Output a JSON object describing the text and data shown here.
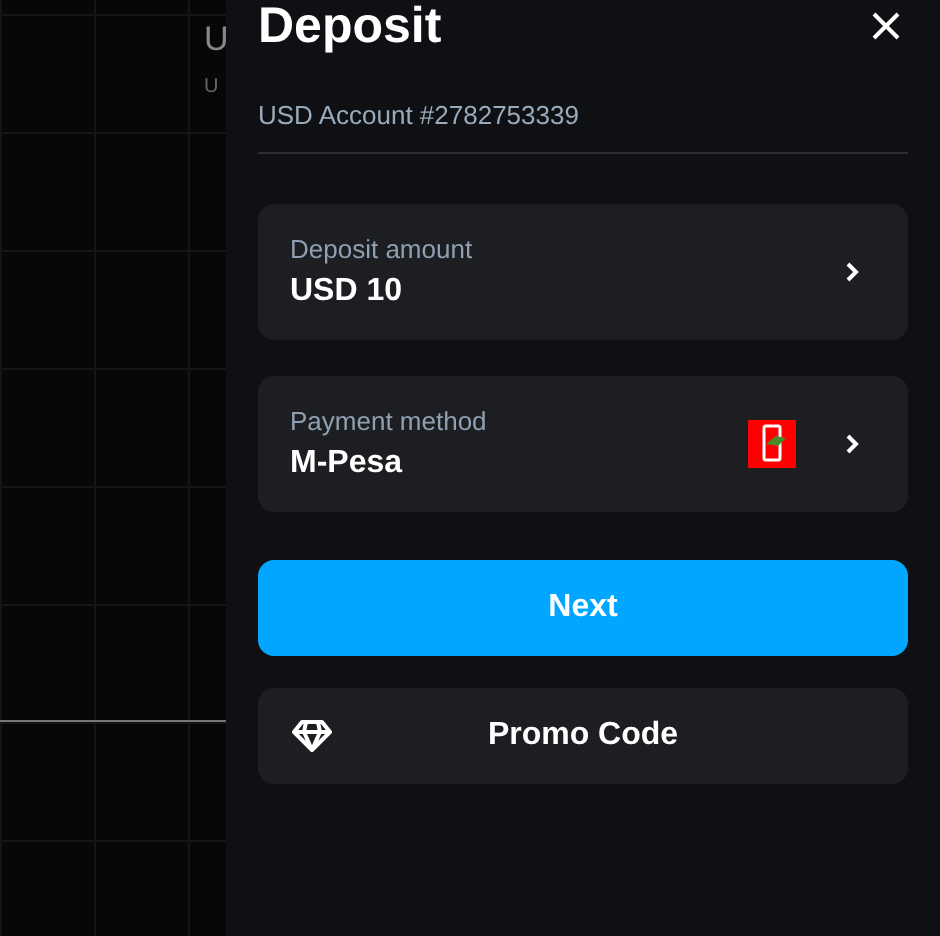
{
  "background": {
    "title": "U",
    "subtitle": "U"
  },
  "panel": {
    "title": "Deposit",
    "account": "USD Account #2782753339",
    "fields": [
      {
        "kind": "amount",
        "label": "Deposit amount",
        "value": "USD 10"
      },
      {
        "kind": "method",
        "label": "Payment method",
        "value": "M-Pesa"
      }
    ],
    "next_button": "Next",
    "promo_button": "Promo Code"
  }
}
